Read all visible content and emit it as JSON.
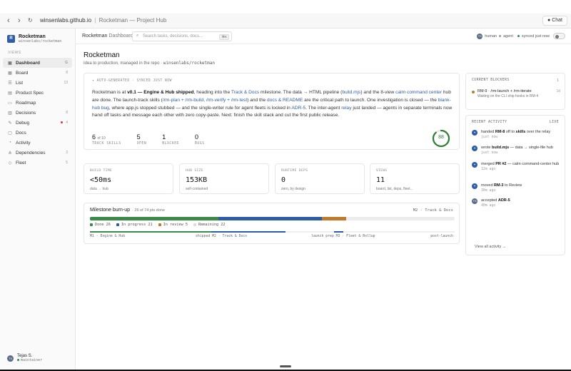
{
  "browser": {
    "url": "winsenlabs.github.io",
    "separator": "|",
    "page_title": "Rocketman — Project Hub",
    "chat_label": "Chat",
    "back_icon": "‹",
    "forward_icon": "›",
    "reload_icon": "↻"
  },
  "brand": {
    "name": "Rocketman",
    "slug": "winsenlabs/rocketman",
    "logo_text": "R"
  },
  "sidebar": {
    "section": "VIEWS",
    "items": [
      {
        "label": "Dashboard",
        "icon": "▣",
        "count": "G"
      },
      {
        "label": "Board",
        "icon": "▦",
        "count": "8"
      },
      {
        "label": "List",
        "icon": "☰",
        "count": "13"
      },
      {
        "label": "Product Spec",
        "icon": "▤",
        "count": ""
      },
      {
        "label": "Roadmap",
        "icon": "▭",
        "count": ""
      },
      {
        "label": "Decisions",
        "icon": "▥",
        "count": "8"
      },
      {
        "label": "Debug",
        "icon": "✎",
        "count": "4"
      },
      {
        "label": "Docs",
        "icon": "▢",
        "count": ""
      },
      {
        "label": "Activity",
        "icon": "◔",
        "count": ""
      },
      {
        "label": "Dependencies",
        "icon": "⋔",
        "count": "3"
      },
      {
        "label": "Fleet",
        "icon": "◇",
        "count": "5"
      }
    ],
    "user": {
      "initials": "TS",
      "name": "Tejas S.",
      "role": "maintainer"
    }
  },
  "header": {
    "crumb_app": "Rocketman",
    "crumb_page": "Dashboard",
    "search_placeholder": "Search tasks, decisions, docs...",
    "search_kbd": "⌘K",
    "presence_initials": "TS",
    "presence_human": "human",
    "presence_agent": "agent",
    "sync_status": "synced just now"
  },
  "page": {
    "title": "Rocketman",
    "subtitle": "Idea to production, managed in the repo ·",
    "repo": "winsenlabs/rocketman"
  },
  "summary": {
    "autogen": "✦ AUTO-GENERATED · SYNCED JUST NOW",
    "t1": "Rocketman is at ",
    "version": "v0.1 — Engine & Hub shipped",
    "t2": ", heading into the ",
    "l_track": "Track & Docs",
    "t3": " milestone. The data → HTML pipeline (",
    "l_build": "build.mjs",
    "t4": ") and the 8-view ",
    "l_calm": "calm command center",
    "t5": " hub are done. The launch-track skills (",
    "l_skills": "/rm-plan + /rm-build, /rm-verify + /rm-test",
    "t6": ") and the ",
    "l_docs": "docs & README",
    "t7": " are the critical path to launch. One investigation is closed — the ",
    "l_bug": "blank-hub bug",
    "t8": ", where app.js stopped stubbed — and the single-writer rule for agent fleets is locked in ",
    "l_adr": "ADR-5",
    "t9": ". The inter-agent ",
    "l_relay": "relay",
    "t10": " just landed — agents in separate terminals now hand off tasks and message each other with zero copy-paste. Next: finish the skill stack and cut the first public release.",
    "stats": [
      {
        "value": "6",
        "suffix": "of 10",
        "label": "TRACK SKILLS"
      },
      {
        "value": "5",
        "suffix": "",
        "label": "OPEN"
      },
      {
        "value": "1",
        "suffix": "",
        "label": "BLOCKED"
      },
      {
        "value": "0",
        "suffix": "",
        "label": "BUGS"
      }
    ],
    "health_score": "88",
    "health_fraction": 0.88
  },
  "metrics": [
    {
      "label": "BUILD TIME",
      "value": "<50ms",
      "sub": "data → hub"
    },
    {
      "label": "HUB SIZE",
      "value": "153KB",
      "sub": "self-contained"
    },
    {
      "label": "RUNTIME DEPS",
      "value": "0",
      "sub": "zero, by design"
    },
    {
      "label": "VIEWS",
      "value": "11",
      "sub": "board, list, deps, fleet..."
    }
  ],
  "burnup": {
    "title": "Milestone burn-up",
    "subtitle": "· 26 of 74 pts done",
    "right": "M2 · Track & Docs",
    "segments": [
      {
        "name": "Done",
        "value": 26,
        "color": "#3a8a4a"
      },
      {
        "name": "In progress",
        "value": 21,
        "color": "#2d5da8"
      },
      {
        "name": "In review",
        "value": 5,
        "color": "#c07a2a"
      },
      {
        "name": "Remaining",
        "value": 22,
        "color": "#ececec"
      }
    ],
    "legend": [
      "Done 26",
      "In progress 21",
      "In review 5",
      "Remaining 22"
    ],
    "milestones": [
      "M1 · Engine & Hub",
      "shipped M2 · Track & Docs",
      "launch prep M3 · Fleet & Rollup",
      "post-launch"
    ]
  },
  "blockers": {
    "title": "CURRENT BLOCKERS",
    "count": "1",
    "item": {
      "text": "RM-9 · /rm-launch + /rm-iterate",
      "sub": "Waiting on the CLI ship hooks in RM-4",
      "age": "1d"
    }
  },
  "activity": {
    "title": "RECENT ACTIVITY",
    "live": "LIVE",
    "items": [
      {
        "avatar": "✦",
        "pre": "handed ",
        "bold": "RM-8",
        "mid": " off to ",
        "bold2": "skills",
        "post": " over the relay",
        "when": "just now"
      },
      {
        "avatar": "✦",
        "pre": "wrote ",
        "bold": "build.mjs",
        "mid": " — data → single-file hub",
        "bold2": "",
        "post": "",
        "when": "just now"
      },
      {
        "avatar": "✦",
        "pre": "merged ",
        "bold": "PR #2",
        "mid": " — calm command-center hub",
        "bold2": "",
        "post": "",
        "when": "12m ago"
      },
      {
        "avatar": "✦",
        "pre": "moved ",
        "bold": "RM-3",
        "mid": " to Review",
        "bold2": "",
        "post": "",
        "when": "30m ago"
      },
      {
        "avatar": "TS",
        "pre": "accepted ",
        "bold": "ADR-5",
        "mid": "",
        "bold2": "",
        "post": "",
        "when": "40m ago"
      }
    ],
    "view_all": "View all activity →"
  }
}
